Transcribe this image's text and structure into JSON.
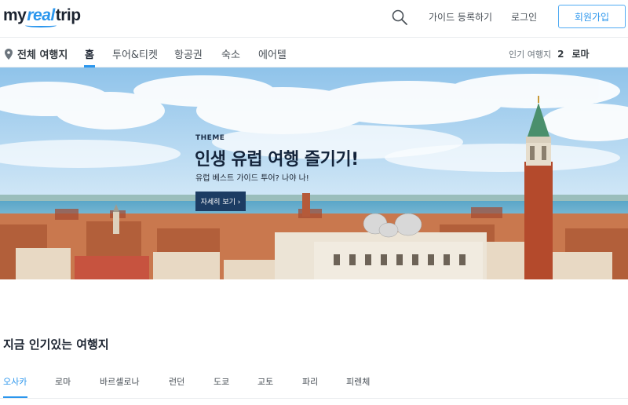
{
  "header": {
    "logo": {
      "part1": "my",
      "part2": "real",
      "part3": "trip"
    },
    "links": [
      "가이드 등록하기",
      "로그인"
    ],
    "signup_label": "회원가입"
  },
  "nav": {
    "destination_label": "전체 여행지",
    "items": [
      "홈",
      "투어&티켓",
      "항공권",
      "숙소",
      "에어텔"
    ],
    "active_index": 0,
    "popular_label": "인기 여행지",
    "popular_rank": "2",
    "popular_city": "로마"
  },
  "hero": {
    "tag": "THEME",
    "title": "인생 유럽 여행 즐기기!",
    "subtitle": "유럽 베스트 가이드 투어? 나야 나!",
    "button_label": "자세히 보기 ›"
  },
  "popular": {
    "title": "지금 인기있는 여행지",
    "tabs": [
      "오사카",
      "로마",
      "바르셀로나",
      "런던",
      "도쿄",
      "교토",
      "파리",
      "피렌체"
    ],
    "active_index": 0
  },
  "colors": {
    "brand": "#2b96ed",
    "hero_button": "#1c3c63",
    "text_dark": "#1b2330"
  },
  "icons": [
    "search-icon",
    "map-pin-icon"
  ]
}
